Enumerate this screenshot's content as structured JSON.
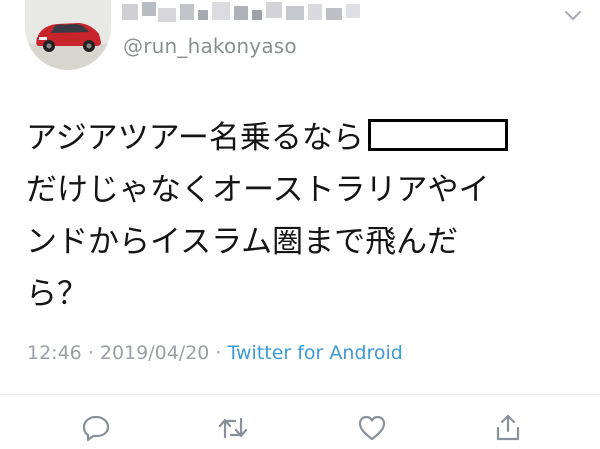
{
  "tweet": {
    "handle": "@run_hakonyaso",
    "text_lines": [
      "アジアツアー名乗るなら",
      "だけじゃなくオーストラリアやイ",
      "ンドからイスラム圏まで飛んだ",
      "ら？"
    ],
    "timestamp": "12:46 · 2019/04/20 · ",
    "source": "Twitter for Android"
  },
  "icons": {
    "avatar": "avatar-red-car",
    "caret": "chevron-down-icon",
    "reply": "reply-icon",
    "retweet": "retweet-icon",
    "like": "heart-icon",
    "share": "share-icon"
  },
  "colors": {
    "text": "#141414",
    "secondary": "#9aa0a6",
    "link": "#3d9ad8",
    "icon": "#8a9099"
  }
}
